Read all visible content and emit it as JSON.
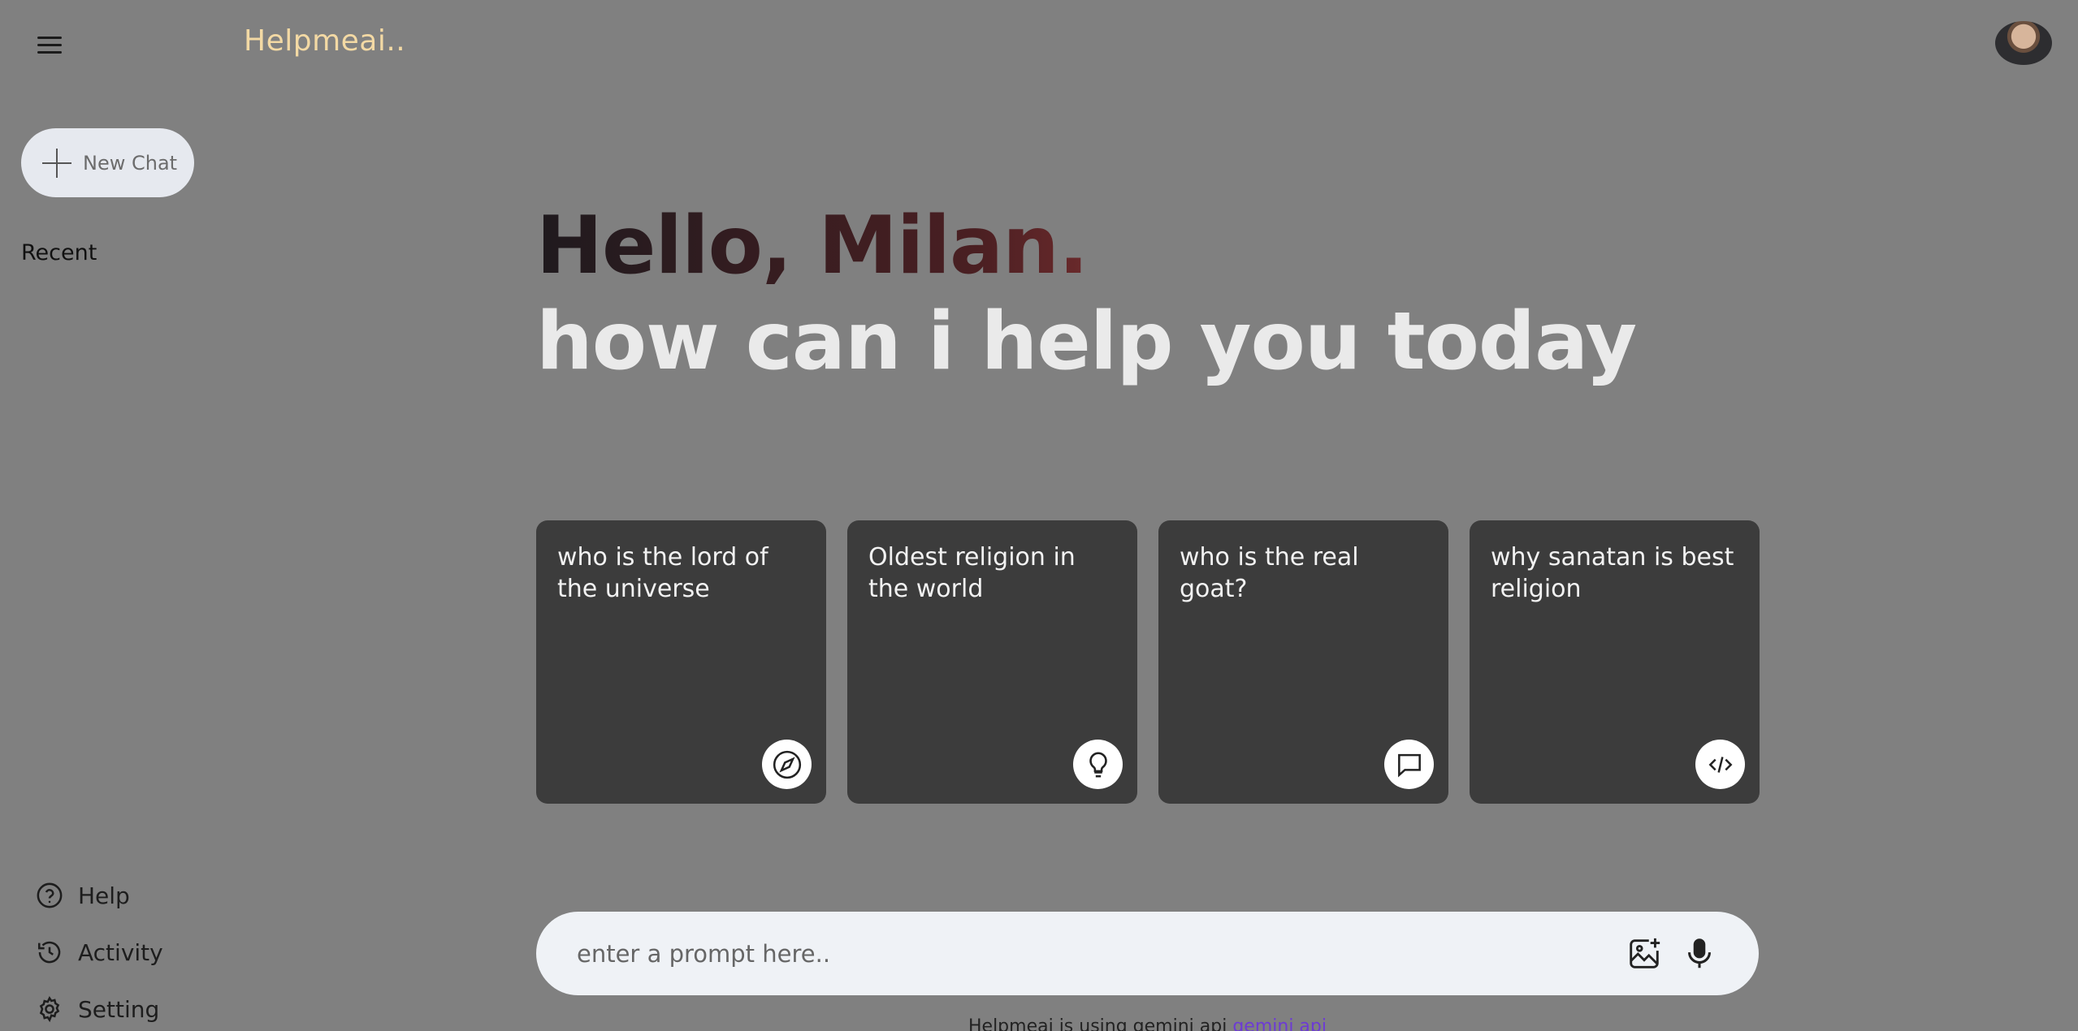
{
  "header": {
    "brand": "Helpmeai.."
  },
  "sidebar": {
    "new_chat_label": "New Chat",
    "recent_label": "Recent",
    "bottom_items": [
      {
        "label": "Help",
        "icon": "help-circle-icon"
      },
      {
        "label": "Activity",
        "icon": "history-icon"
      },
      {
        "label": "Setting",
        "icon": "gear-icon"
      }
    ]
  },
  "greeting": {
    "hello": "Hello, Milan.",
    "subtitle": "how can i help you today"
  },
  "cards": [
    {
      "text": "who is the lord of the universe",
      "icon": "compass-icon"
    },
    {
      "text": "Oldest religion in the world",
      "icon": "lightbulb-icon"
    },
    {
      "text": "who is the real goat?",
      "icon": "message-icon"
    },
    {
      "text": "why sanatan is best religion",
      "icon": "code-icon"
    }
  ],
  "prompt": {
    "placeholder": "enter a prompt here.."
  },
  "footer": {
    "text": "Helpmeai is using gemini api",
    "link_text": "gemini api"
  },
  "colors": {
    "background": "#808080",
    "card": "#3c3c3c",
    "brand": "#f3d9a4",
    "accent": "#e14b3d"
  }
}
